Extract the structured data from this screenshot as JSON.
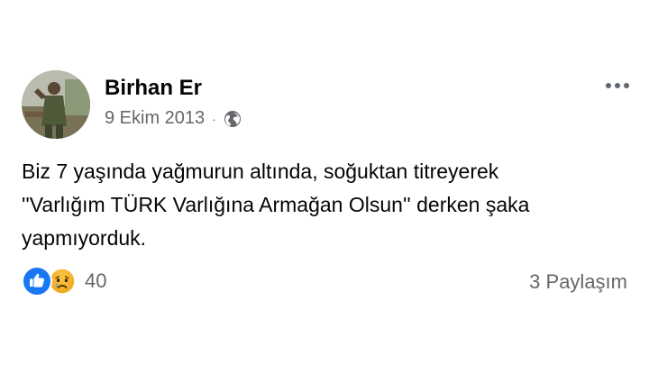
{
  "post": {
    "author_name": "Birhan Er",
    "date": "9 Ekim 2013",
    "separator": "·",
    "privacy_icon": "globe-icon",
    "options_icon": "more-options-icon",
    "text": "Biz 7 yaşında yağmurun altında, soğuktan titreyerek\n''Varlığım TÜRK Varlığına Armağan Olsun'' derken şaka\nyapmıyorduk.",
    "reactions": {
      "icons": [
        "like-icon",
        "sad-icon"
      ],
      "count": "40"
    },
    "shares_label": "3 Paylaşım"
  },
  "colors": {
    "primary_text": "#050505",
    "secondary_text": "#65676b",
    "like_blue": "#1877f2",
    "sad_yellow": "#f7b125"
  }
}
